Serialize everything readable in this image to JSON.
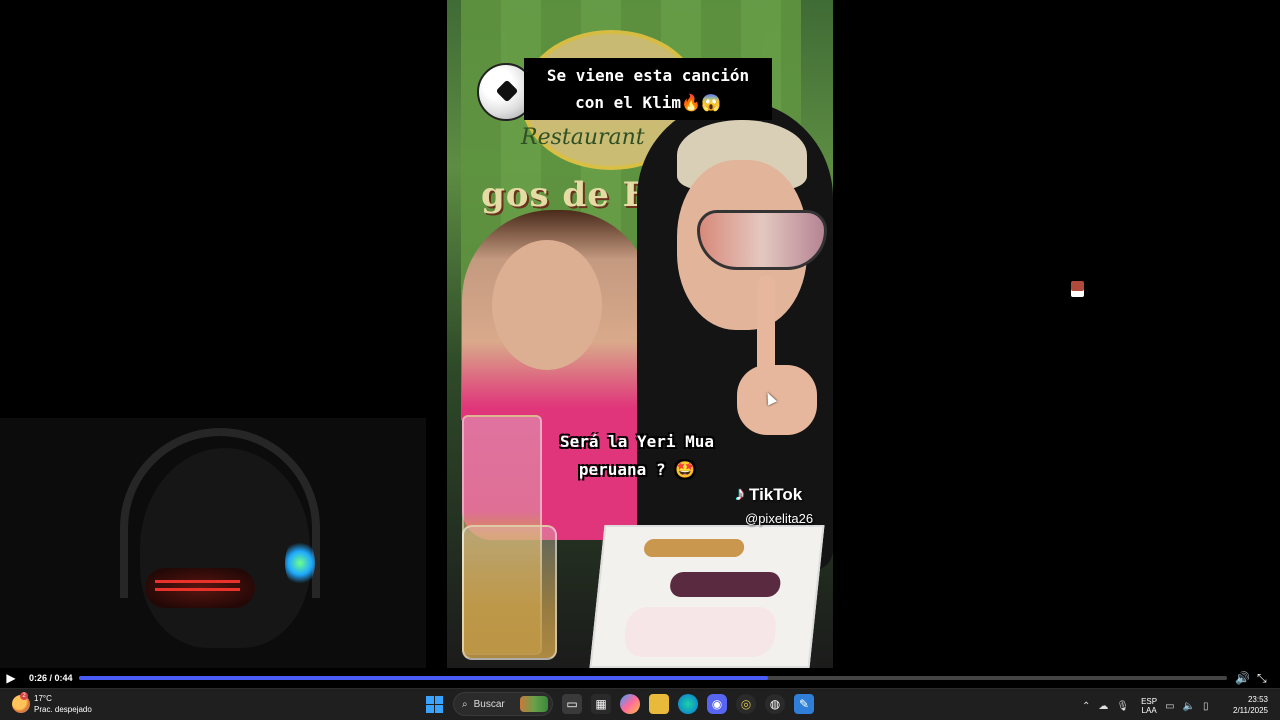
{
  "video": {
    "caption_top_line1": "Se viene esta canción",
    "caption_top_line2": "con el Klim🔥😱",
    "caption_mid_line1": "Será la Yeri Mua",
    "caption_mid_line2": "peruana ? 🤩",
    "tiktok_brand": "TikTok",
    "tiktok_handle": "@pixelita26",
    "poster_text": "gos de Frit",
    "poster_word": "Restaurant"
  },
  "player": {
    "time": "0:26 / 0:44",
    "progress_fraction": 0.6,
    "play_icon": "play-icon",
    "volume_icon": "volume-icon",
    "fullscreen_icon": "fullscreen-icon",
    "accent_color": "#4b5bf5"
  },
  "taskbar": {
    "weather_temp": "17°C",
    "weather_desc": "Prac. despejado",
    "weather_badge": "2",
    "search_placeholder": "Buscar",
    "lang_line1": "ESP",
    "lang_line2": "LAA",
    "clock_time": "23:53",
    "clock_date": "2/11/2025",
    "apps": [
      "start-icon",
      "search-icon",
      "task-view-icon",
      "store-icon",
      "copilot-icon",
      "file-explorer-icon",
      "edge-icon",
      "discord-icon",
      "app-icon",
      "obs-icon",
      "editor-icon"
    ]
  }
}
